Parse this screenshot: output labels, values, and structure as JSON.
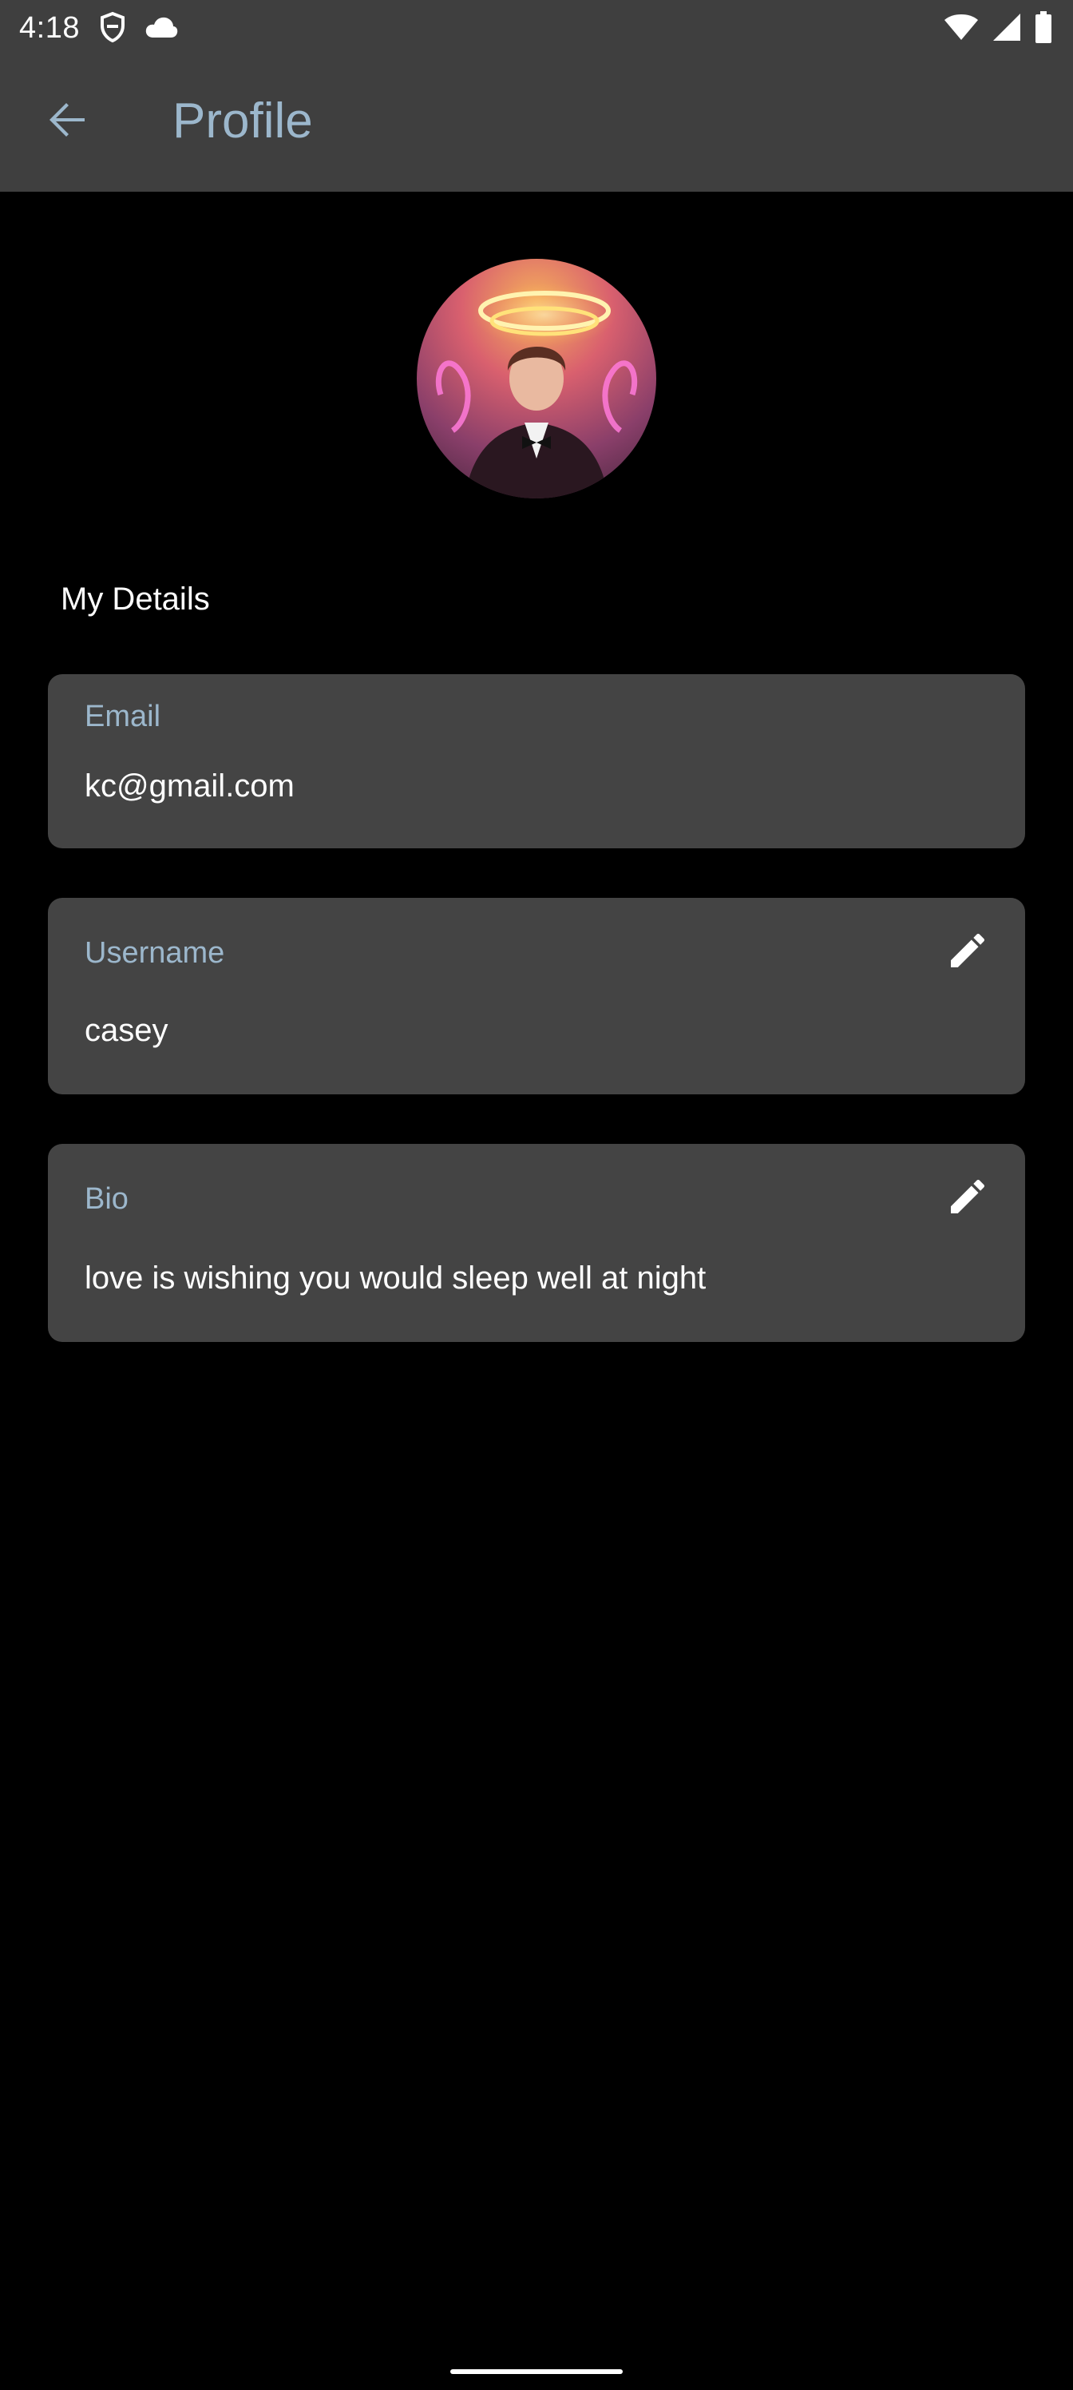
{
  "status_bar": {
    "time": "4:18",
    "icons": [
      "shield-notification-icon",
      "cloud-icon",
      "wifi-icon",
      "signal-icon",
      "battery-icon"
    ]
  },
  "app_bar": {
    "title": "Profile",
    "back_icon": "arrow-back-icon"
  },
  "profile": {
    "avatar": "profile-photo"
  },
  "details": {
    "section_title": "My Details",
    "email": {
      "label": "Email",
      "value": "kc@gmail.com"
    },
    "username": {
      "label": "Username",
      "value": "casey",
      "edit_icon": "pencil-icon"
    },
    "bio": {
      "label": "Bio",
      "value": "love is wishing you would sleep well at night",
      "edit_icon": "pencil-icon"
    }
  },
  "colors": {
    "bar_background": "#3f3f3f",
    "page_background": "#000000",
    "card_background": "#444444",
    "accent_label": "#9cb7cc",
    "text": "#ffffff"
  }
}
